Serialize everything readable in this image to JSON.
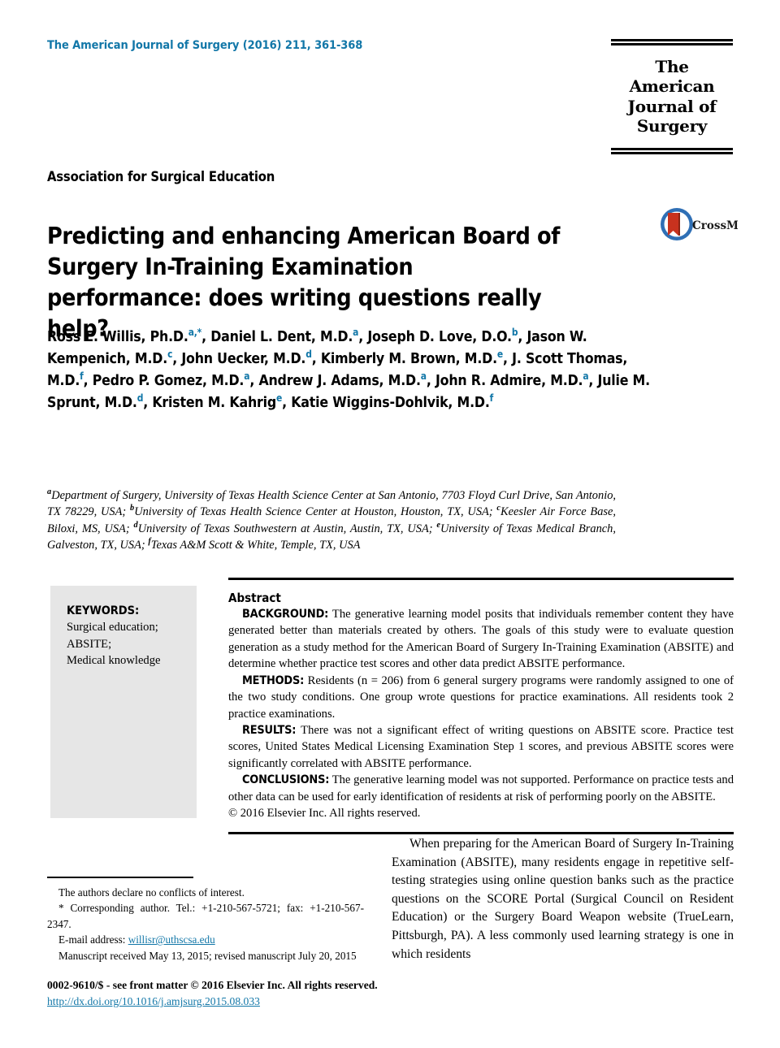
{
  "header": {
    "running_head": "The American Journal of Surgery (2016) 211, 361-368",
    "accent_color": "#1277a8"
  },
  "journal_logo": {
    "line1": "The American",
    "line2": "Journal of Surgery"
  },
  "society_line": "Association for Surgical Education",
  "title": "Predicting and enhancing American Board of Surgery In-Training Examination performance: does writing questions really help?",
  "crossmark": {
    "label": "CrossMark",
    "disc_color": "#2f6fb5",
    "bookmark_color": "#c8321e"
  },
  "authors": [
    {
      "name": "Ross E. Willis, Ph.D.",
      "marks": "a,*",
      "sep": ", "
    },
    {
      "name": "Daniel L. Dent, M.D.",
      "marks": "a",
      "sep": ", "
    },
    {
      "name": "Joseph D. Love, D.O.",
      "marks": "b",
      "sep": ", "
    },
    {
      "name": "Jason W. Kempenich, M.D.",
      "marks": "c",
      "sep": ", "
    },
    {
      "name": "John Uecker, M.D.",
      "marks": "d",
      "sep": ", "
    },
    {
      "name": "Kimberly M. Brown, M.D.",
      "marks": "e",
      "sep": ", "
    },
    {
      "name": "J. Scott Thomas, M.D.",
      "marks": "f",
      "sep": ", "
    },
    {
      "name": "Pedro P. Gomez, M.D.",
      "marks": "a",
      "sep": ", "
    },
    {
      "name": "Andrew J. Adams, M.D.",
      "marks": "a",
      "sep": ", "
    },
    {
      "name": "John R. Admire, M.D.",
      "marks": "a",
      "sep": ", "
    },
    {
      "name": "Julie M. Sprunt, M.D.",
      "marks": "d",
      "sep": ", "
    },
    {
      "name": "Kristen M. Kahrig",
      "marks": "e",
      "sep": ", "
    },
    {
      "name": "Katie Wiggins-Dohlvik, M.D.",
      "marks": "f",
      "sep": ""
    }
  ],
  "affiliations": [
    {
      "mark": "a",
      "text": "Department of Surgery, University of Texas Health Science Center at San Antonio, 7703 Floyd Curl Drive, San Antonio, TX 78229, USA; "
    },
    {
      "mark": "b",
      "text": "University of Texas Health Science Center at Houston, Houston, TX, USA; "
    },
    {
      "mark": "c",
      "text": "Keesler Air Force Base, Biloxi, MS, USA; "
    },
    {
      "mark": "d",
      "text": "University of Texas Southwestern at Austin, Austin, TX, USA; "
    },
    {
      "mark": "e",
      "text": "University of Texas Medical Branch, Galveston, TX, USA; "
    },
    {
      "mark": "f",
      "text": "Texas A&M Scott & White, Temple, TX, USA"
    }
  ],
  "keywords": {
    "heading": "KEYWORDS:",
    "items": [
      "Surgical education;",
      "ABSITE;",
      "Medical knowledge"
    ]
  },
  "abstract": {
    "heading": "Abstract",
    "sections": [
      {
        "label": "BACKGROUND:",
        "text": "The generative learning model posits that individuals remember content they have generated better than materials created by others. The goals of this study were to evaluate question generation as a study method for the American Board of Surgery In-Training Examination (ABSITE) and determine whether practice test scores and other data predict ABSITE performance."
      },
      {
        "label": "METHODS:",
        "text": "Residents (n = 206) from 6 general surgery programs were randomly assigned to one of the two study conditions. One group wrote questions for practice examinations. All residents took 2 practice examinations."
      },
      {
        "label": "RESULTS:",
        "text": "There was not a significant effect of writing questions on ABSITE score. Practice test scores, United States Medical Licensing Examination Step 1 scores, and previous ABSITE scores were significantly correlated with ABSITE performance."
      },
      {
        "label": "CONCLUSIONS:",
        "text": "The generative learning model was not supported. Performance on practice tests and other data can be used for early identification of residents at risk of performing poorly on the ABSITE."
      }
    ],
    "copyright": "© 2016 Elsevier Inc. All rights reserved."
  },
  "body_text": "When preparing for the American Board of Surgery In-Training Examination (ABSITE), many residents engage in repetitive self-testing strategies using online question banks such as the practice questions on the SCORE Portal (Surgical Council on Resident Education) or the Surgery Board Weapon website (TrueLearn, Pittsburgh, PA). A less commonly used learning strategy is one in which residents",
  "footnotes": {
    "conflicts": "The authors declare no conflicts of interest.",
    "corresponding_prefix": "* Corresponding author. Tel.: +1-210-567-5721; fax: +1-210-567-2347.",
    "email_label": "E-mail address:",
    "email": "willisr@uthscsa.edu",
    "manuscript_dates": "Manuscript received May 13, 2015; revised manuscript July 20, 2015"
  },
  "colophon": {
    "issn_line": "0002-9610/$ - see front matter © 2016 Elsevier Inc. All rights reserved.",
    "doi": "http://dx.doi.org/10.1016/j.amjsurg.2015.08.033"
  }
}
